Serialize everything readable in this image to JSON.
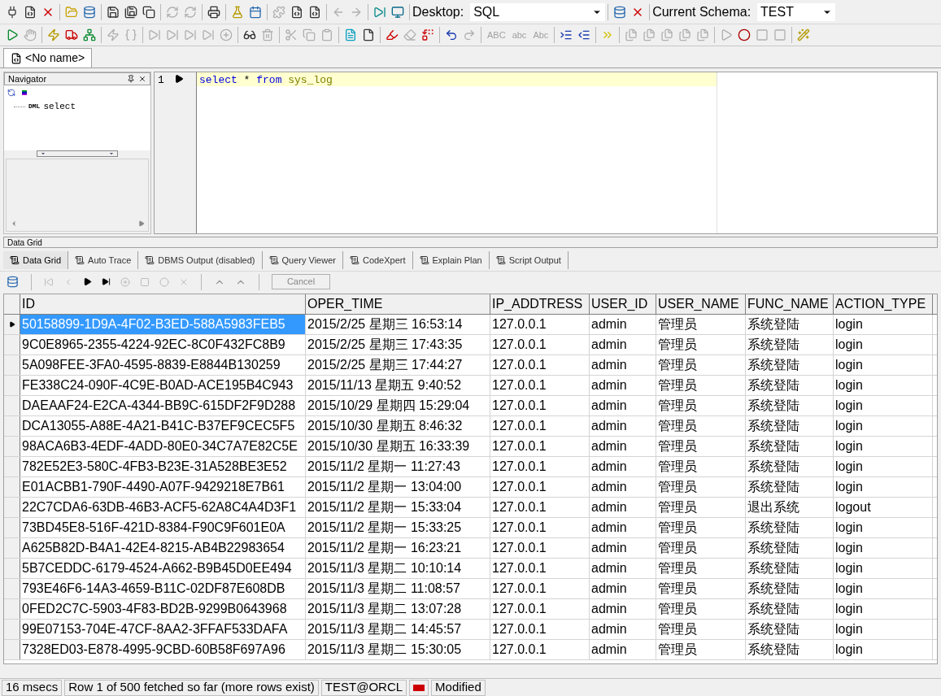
{
  "toolbar_1": [
    {
      "kind": "plug",
      "disabled": false
    },
    {
      "kind": "sql",
      "disabled": false
    },
    {
      "kind": "disconnect",
      "disabled": false
    },
    {
      "kind": "folder",
      "disabled": false
    },
    {
      "kind": "database",
      "disabled": false
    },
    {
      "kind": "save",
      "disabled": false
    },
    {
      "kind": "saveas",
      "disabled": false
    },
    {
      "kind": "copy",
      "disabled": false
    },
    {
      "kind": "refresh",
      "disabled": true
    },
    {
      "kind": "refresh",
      "disabled": true
    },
    {
      "kind": "printer",
      "disabled": false
    },
    {
      "kind": "flask",
      "disabled": false
    },
    {
      "kind": "calendar",
      "disabled": false
    },
    {
      "kind": "puzzle",
      "disabled": true
    },
    {
      "kind": "sql",
      "disabled": false
    },
    {
      "kind": "sql",
      "disabled": false
    },
    {
      "kind": "back",
      "disabled": true
    },
    {
      "kind": "forward",
      "disabled": true
    },
    {
      "kind": "step",
      "disabled": false
    },
    {
      "kind": "monitor",
      "disabled": false
    }
  ],
  "desktop": {
    "label": "Desktop:",
    "value": "SQL"
  },
  "toolbar_1b": [
    {
      "kind": "database",
      "disabled": false
    },
    {
      "kind": "disconnect",
      "disabled": false
    }
  ],
  "schema": {
    "label": "Current Schema:",
    "value": "TEST"
  },
  "toolbar_2": [
    {
      "kind": "play",
      "disabled": false
    },
    {
      "kind": "hand",
      "disabled": true
    },
    {
      "kind": "zap",
      "disabled": false
    },
    {
      "kind": "truck",
      "disabled": false
    },
    {
      "kind": "tree",
      "disabled": false
    },
    {
      "kind": "zap",
      "disabled": true
    },
    {
      "kind": "braces",
      "disabled": true
    },
    {
      "kind": "step",
      "disabled": true
    },
    {
      "kind": "step",
      "disabled": true
    },
    {
      "kind": "step",
      "disabled": true
    },
    {
      "kind": "step",
      "disabled": true
    },
    {
      "kind": "plus",
      "disabled": true
    },
    {
      "kind": "glasses",
      "disabled": false
    },
    {
      "kind": "trash",
      "disabled": true
    },
    {
      "kind": "scissors",
      "disabled": true
    },
    {
      "kind": "copy",
      "disabled": true
    },
    {
      "kind": "clipboard",
      "disabled": true
    },
    {
      "kind": "doc",
      "disabled": false
    },
    {
      "kind": "file",
      "disabled": false
    },
    {
      "kind": "highlighter",
      "disabled": false
    },
    {
      "kind": "eraser",
      "disabled": true
    },
    {
      "kind": "replace",
      "disabled": false
    },
    {
      "kind": "undo",
      "disabled": false
    },
    {
      "kind": "redo",
      "disabled": true
    },
    {
      "kind": "text",
      "label": "ABC",
      "disabled": true
    },
    {
      "kind": "text",
      "label": "abc",
      "disabled": true
    },
    {
      "kind": "text",
      "label": "Abc",
      "disabled": true
    },
    {
      "kind": "indent",
      "disabled": false
    },
    {
      "kind": "outdent",
      "disabled": false
    },
    {
      "kind": "chevrons",
      "disabled": false
    },
    {
      "kind": "files",
      "disabled": true
    },
    {
      "kind": "files",
      "disabled": true
    },
    {
      "kind": "files",
      "disabled": true
    },
    {
      "kind": "files",
      "disabled": true
    },
    {
      "kind": "files",
      "disabled": true
    },
    {
      "kind": "play",
      "disabled": true
    },
    {
      "kind": "record",
      "disabled": false
    },
    {
      "kind": "square",
      "disabled": true
    },
    {
      "kind": "square",
      "disabled": true
    },
    {
      "kind": "wand",
      "disabled": false
    }
  ],
  "document_tab": {
    "label": "<No name>",
    "selected": true
  },
  "navigator": {
    "title": "Navigator",
    "items": [
      {
        "badge": "DML",
        "label": "select"
      }
    ]
  },
  "editor": {
    "line_number": "1",
    "code": [
      {
        "kind": "keyword",
        "text": "select"
      },
      {
        "kind": "operator",
        "text": "*"
      },
      {
        "kind": "keyword",
        "text": "from"
      },
      {
        "kind": "name",
        "text": "sys_log"
      }
    ]
  },
  "panel_title": "Data Grid",
  "result_tabs": [
    {
      "label": "Data Grid",
      "selected": true
    },
    {
      "label": "Auto Trace",
      "selected": false
    },
    {
      "label": "DBMS Output (disabled)",
      "selected": false
    },
    {
      "label": "Query Viewer",
      "selected": false
    },
    {
      "label": "CodeXpert",
      "selected": false
    },
    {
      "label": "Explain Plan",
      "selected": false
    },
    {
      "label": "Script Output",
      "selected": false
    }
  ],
  "grid_toolbar": {
    "cancel": {
      "label": "Cancel",
      "disabled": true
    }
  },
  "table": {
    "columns": [
      "ID",
      "OPER_TIME",
      "IP_ADDTRESS",
      "USER_ID",
      "USER_NAME",
      "FUNC_NAME",
      "ACTION_TYPE"
    ],
    "rows": [
      {
        "selected": true,
        "cells": [
          "50158899-1D9A-4F02-B3ED-588A5983FEB5",
          "2015/2/25 星期三 16:53:14",
          "127.0.0.1",
          "admin",
          "管理员",
          "系统登陆",
          "login"
        ]
      },
      {
        "selected": false,
        "cells": [
          "9C0E8965-2355-4224-92EC-8C0F432FC8B9",
          "2015/2/25 星期三 17:43:35",
          "127.0.0.1",
          "admin",
          "管理员",
          "系统登陆",
          "login"
        ]
      },
      {
        "selected": false,
        "cells": [
          "5A098FEE-3FA0-4595-8839-E8844B130259",
          "2015/2/25 星期三 17:44:27",
          "127.0.0.1",
          "admin",
          "管理员",
          "系统登陆",
          "login"
        ]
      },
      {
        "selected": false,
        "cells": [
          "FE338C24-090F-4C9E-B0AD-ACE195B4C943",
          "2015/11/13 星期五 9:40:52",
          "127.0.0.1",
          "admin",
          "管理员",
          "系统登陆",
          "login"
        ]
      },
      {
        "selected": false,
        "cells": [
          "DAEAAF24-E2CA-4344-BB9C-615DF2F9D288",
          "2015/10/29 星期四 15:29:04",
          "127.0.0.1",
          "admin",
          "管理员",
          "系统登陆",
          "login"
        ]
      },
      {
        "selected": false,
        "cells": [
          "DCA13055-A88E-4A21-B41C-B37EF9CEC5F5",
          "2015/10/30 星期五 8:46:32",
          "127.0.0.1",
          "admin",
          "管理员",
          "系统登陆",
          "login"
        ]
      },
      {
        "selected": false,
        "cells": [
          "98ACA6B3-4EDF-4ADD-80E0-34C7A7E82C5E",
          "2015/10/30 星期五 16:33:39",
          "127.0.0.1",
          "admin",
          "管理员",
          "系统登陆",
          "login"
        ]
      },
      {
        "selected": false,
        "cells": [
          "782E52E3-580C-4FB3-B23E-31A528BE3E52",
          "2015/11/2 星期一 11:27:43",
          "127.0.0.1",
          "admin",
          "管理员",
          "系统登陆",
          "login"
        ]
      },
      {
        "selected": false,
        "cells": [
          "E01ACBB1-790F-4490-A07F-9429218E7B61",
          "2015/11/2 星期一 13:04:00",
          "127.0.0.1",
          "admin",
          "管理员",
          "系统登陆",
          "login"
        ]
      },
      {
        "selected": false,
        "cells": [
          "22C7CDA6-63DB-46B3-ACF5-62A8C4A4D3F1",
          "2015/11/2 星期一 15:33:04",
          "127.0.0.1",
          "admin",
          "管理员",
          "退出系统",
          "logout"
        ]
      },
      {
        "selected": false,
        "cells": [
          "73BD45E8-516F-421D-8384-F90C9F601E0A",
          "2015/11/2 星期一 15:33:25",
          "127.0.0.1",
          "admin",
          "管理员",
          "系统登陆",
          "login"
        ]
      },
      {
        "selected": false,
        "cells": [
          "A625B82D-B4A1-42E4-8215-AB4B22983654",
          "2015/11/2 星期一 16:23:21",
          "127.0.0.1",
          "admin",
          "管理员",
          "系统登陆",
          "login"
        ]
      },
      {
        "selected": false,
        "cells": [
          "5B7CEDDC-6179-4524-A662-B9B45D0EE494",
          "2015/11/3 星期二 10:10:14",
          "127.0.0.1",
          "admin",
          "管理员",
          "系统登陆",
          "login"
        ]
      },
      {
        "selected": false,
        "cells": [
          "793E46F6-14A3-4659-B11C-02DF87E608DB",
          "2015/11/3 星期二 11:08:57",
          "127.0.0.1",
          "admin",
          "管理员",
          "系统登陆",
          "login"
        ]
      },
      {
        "selected": false,
        "cells": [
          "0FED2C7C-5903-4F83-BD2B-9299B0643968",
          "2015/11/3 星期二 13:07:28",
          "127.0.0.1",
          "admin",
          "管理员",
          "系统登陆",
          "login"
        ]
      },
      {
        "selected": false,
        "cells": [
          "99E07153-704E-47CF-8AA2-3FFAF533DAFA",
          "2015/11/3 星期二 14:45:57",
          "127.0.0.1",
          "admin",
          "管理员",
          "系统登陆",
          "login"
        ]
      },
      {
        "selected": false,
        "cells": [
          "7328ED03-E878-4995-9CBD-60B58F697A96",
          "2015/11/3 星期二 15:30:05",
          "127.0.0.1",
          "admin",
          "管理员",
          "系统登陆",
          "login"
        ]
      }
    ]
  },
  "status_bar": [
    "16 msecs",
    "Row 1 of 500 fetched so far (more rows exist)",
    "TEST@ORCL",
    "Modified"
  ]
}
